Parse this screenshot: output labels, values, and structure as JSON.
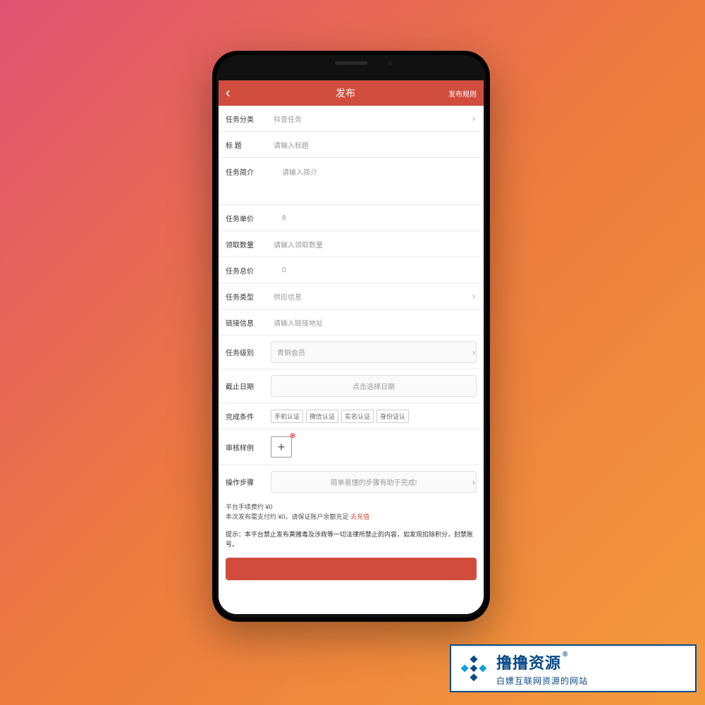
{
  "nav": {
    "title": "发布",
    "right": "发布规则"
  },
  "rows": {
    "category": {
      "label": "任务分类",
      "value": "抖音任务"
    },
    "title": {
      "label": "标 题",
      "placeholder": "请输入标题"
    },
    "intro": {
      "label": "任务简介",
      "placeholder": "请输入简介"
    },
    "price": {
      "label": "任务单价",
      "placeholder": "8"
    },
    "qty": {
      "label": "领取数量",
      "placeholder": "请输入领取数量"
    },
    "total": {
      "label": "任务总价",
      "value": "0"
    },
    "type": {
      "label": "任务类型",
      "value": "供应信息"
    },
    "link": {
      "label": "链接信息",
      "placeholder": "请输入链接地址"
    },
    "level": {
      "label": "任务级别",
      "value": "青铜会员"
    },
    "deadline": {
      "label": "截止日期",
      "placeholder": "点击选择日期"
    },
    "conditions": {
      "label": "完成条件",
      "tags": [
        "手机认证",
        "微信认证",
        "实名认证",
        "身份证认"
      ]
    },
    "sample": {
      "label": "审核样例"
    },
    "steps": {
      "label": "操作步骤",
      "placeholder": "简单易懂的步骤有助于完成!"
    }
  },
  "footer": {
    "line1": "平台手续费约 ¥0",
    "line2a": "本次发布需支付约 ¥0，请保证账户余额充足 ",
    "line2b": "去充值",
    "warning": "提示：本平台禁止发布黄赌毒及涉政等一切法律所禁止的内容，如发现扣除积分，封禁账号。"
  },
  "badge": {
    "big": "撸撸资源",
    "reg": "®",
    "small": "白嫖互联网资源的网站"
  }
}
